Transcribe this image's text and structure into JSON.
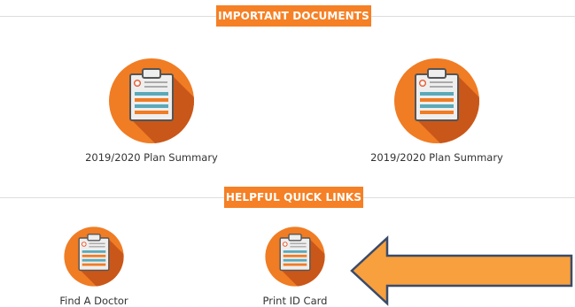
{
  "sections": {
    "documents_title": "IMPORTANT DOCUMENTS",
    "quick_links_title": "HELPFUL QUICK LINKS"
  },
  "documents": [
    {
      "label": "2019/2020 Plan Summary",
      "icon": "clipboard-document-icon"
    },
    {
      "label": "2019/2020 Plan Summary",
      "icon": "clipboard-document-icon"
    }
  ],
  "quick_links": [
    {
      "label": "Find A Doctor",
      "icon": "clipboard-document-icon"
    },
    {
      "label": "Print ID Card",
      "icon": "clipboard-document-icon"
    }
  ],
  "annotation": {
    "icon": "left-arrow-icon"
  },
  "colors": {
    "accent": "#f58025",
    "icon_circle": "#f07c24",
    "icon_shadow": "#c9571a",
    "arrow_fill": "#f7a03d",
    "arrow_stroke": "#3a4b6b"
  }
}
